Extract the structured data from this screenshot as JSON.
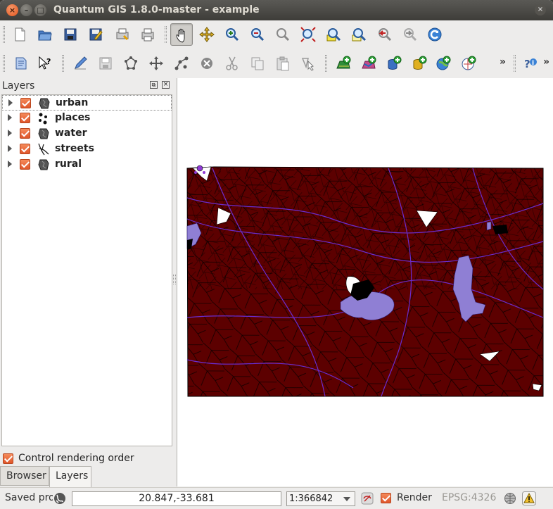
{
  "window": {
    "title": "Quantum GIS 1.8.0-master - example",
    "controls": {
      "close": "×",
      "minimize": "–",
      "maximize": "□",
      "right_close": "×"
    }
  },
  "toolbar_top": {
    "buttons": [
      "new-project-icon",
      "open-project-icon",
      "save-project-icon",
      "save-as-icon",
      "print-composer-icon",
      "print-icon",
      "pan-icon",
      "pan-to-selection-icon",
      "zoom-in-icon",
      "zoom-out-icon",
      "zoom-actual-icon",
      "zoom-full-icon",
      "zoom-layer-icon",
      "zoom-selection-icon",
      "zoom-last-icon",
      "zoom-next-icon",
      "refresh-icon"
    ],
    "active": "pan-icon"
  },
  "toolbar_bottom": {
    "buttons": [
      "identify-features-icon",
      "whats-this-icon",
      "toggle-editing-icon",
      "save-edits-icon",
      "add-feature-icon",
      "move-feature-icon",
      "node-tool-icon",
      "delete-selected-icon",
      "cut-features-icon",
      "copy-features-icon",
      "paste-features-icon",
      "select-features-icon",
      "add-raster-layer-icon",
      "add-vector-layer-icon",
      "add-postgis-layer-icon",
      "add-spatialite-layer-icon",
      "add-wms-layer-icon",
      "add-wfs-layer-icon"
    ],
    "overflow_left": "»",
    "overflow_right": "»"
  },
  "layers_panel": {
    "title": "Layers",
    "float_glyph": "⧉",
    "close_glyph": "×",
    "layers": [
      {
        "name": "urban",
        "checked": true,
        "icon": "polygon-icon"
      },
      {
        "name": "places",
        "checked": true,
        "icon": "point-icon"
      },
      {
        "name": "water",
        "checked": true,
        "icon": "polygon-icon"
      },
      {
        "name": "streets",
        "checked": true,
        "icon": "line-icon"
      },
      {
        "name": "rural",
        "checked": true,
        "icon": "polygon-icon"
      }
    ],
    "control_rendering_order": {
      "label": "Control rendering order",
      "checked": true
    },
    "tabs": [
      {
        "label": "Browser",
        "active": false
      },
      {
        "label": "Layers",
        "active": true
      }
    ]
  },
  "map": {
    "colors": {
      "land": "#5c0000",
      "boundary": "#000000",
      "streets": "#6a2ccf",
      "water": "#8f7fd4",
      "urban": "#ffffff"
    }
  },
  "status_bar": {
    "message": "Saved pro",
    "coordinates": "20.847,-33.681",
    "scale": "1:366842",
    "render_label": "Render",
    "render_checked": true,
    "crs": "EPSG:4326"
  }
}
